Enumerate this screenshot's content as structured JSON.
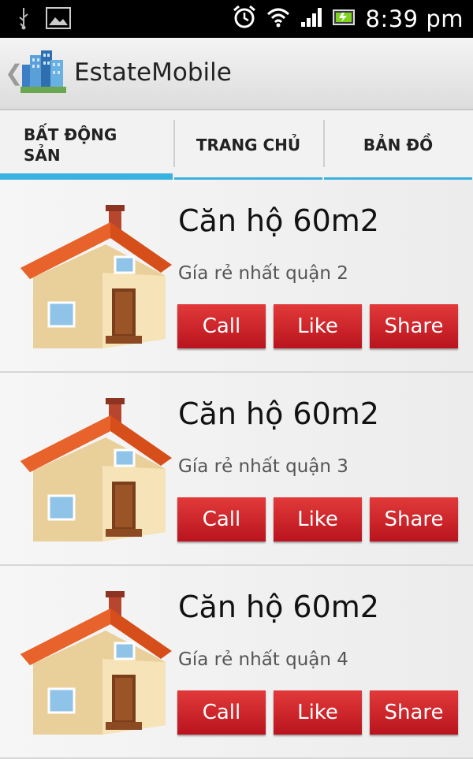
{
  "status_bar": {
    "time": "8:39 pm",
    "icons": [
      "usb-icon",
      "picture-icon",
      "alarm-icon",
      "wifi-icon",
      "signal-icon",
      "battery-icon"
    ]
  },
  "app_bar": {
    "title": "EstateMobile",
    "logo": "buildings-logo-icon",
    "up_icon": "chevron-left-icon"
  },
  "tabs": [
    {
      "label": "BẤT ĐỘNG SẢN",
      "active": true
    },
    {
      "label": "TRANG CHỦ",
      "active": false
    },
    {
      "label": "BẢN ĐỒ",
      "active": false
    }
  ],
  "listings": [
    {
      "title": "Căn hộ 60m2",
      "subtitle": "Gía rẻ nhất quận 2",
      "buttons": [
        "Call",
        "Like",
        "Share"
      ],
      "image": "house-icon"
    },
    {
      "title": "Căn hộ 60m2",
      "subtitle": "Gía rẻ nhất quận 3",
      "buttons": [
        "Call",
        "Like",
        "Share"
      ],
      "image": "house-icon"
    },
    {
      "title": "Căn hộ 60m2",
      "subtitle": "Gía rẻ nhất quận 4",
      "buttons": [
        "Call",
        "Like",
        "Share"
      ],
      "image": "house-icon"
    }
  ],
  "colors": {
    "status_bar_bg": "#000000",
    "tab_indicator": "#39b1e1",
    "button_red": "#c8202a",
    "list_bg": "#ececec"
  }
}
